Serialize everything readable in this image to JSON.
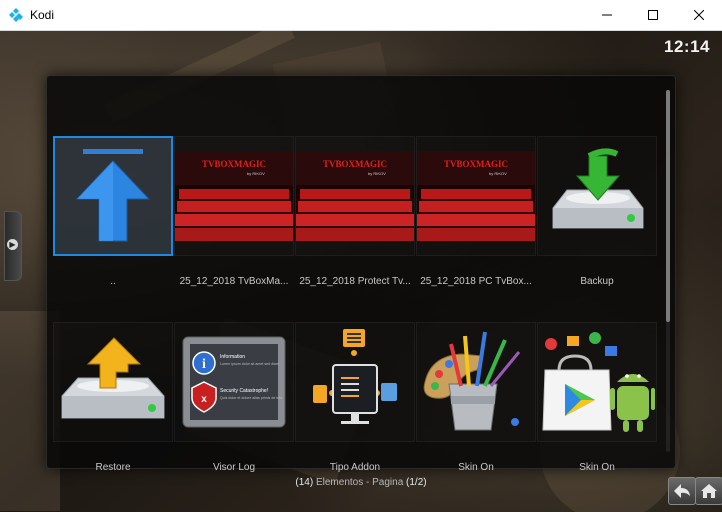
{
  "window": {
    "title": "Kodi",
    "controls": [
      "minimize-icon",
      "maximize-icon",
      "close-icon"
    ]
  },
  "clock": "12:14",
  "grid": {
    "items": [
      {
        "label": "..",
        "icon": "arrow-up-icon"
      },
      {
        "label": "25_12_2018 TvBoxMa...",
        "icon": "cinema-thumbnail"
      },
      {
        "label": "25_12_2018 Protect Tv...",
        "icon": "cinema-thumbnail"
      },
      {
        "label": "25_12_2018 PC TvBox...",
        "icon": "cinema-thumbnail"
      },
      {
        "label": "Backup",
        "icon": "drive-download-icon"
      },
      {
        "label": "Restore",
        "icon": "drive-upload-icon"
      },
      {
        "label": "Visor Log",
        "icon": "log-viewer-icon"
      },
      {
        "label": "Tipo Addon",
        "icon": "addon-type-icon"
      },
      {
        "label": "Skin On",
        "icon": "paint-brushes-icon"
      },
      {
        "label": "Skin On",
        "icon": "play-store-bag-icon"
      }
    ],
    "thumbnail_text": "TVBOXMAGIC",
    "thumbnail_subtext": "by RIKOV",
    "log_text": {
      "title1": "Information",
      "body1": "Lorem ipsum dolor sit amet sed diam",
      "title2": "Security Catastrophe!",
      "body2": "Quis dolor et dolore alias primis de tuta"
    }
  },
  "footer": {
    "count": "(14)",
    "label": " Elementos - Pagina ",
    "page": "(1/2)"
  },
  "colors": {
    "focus": "#1e88e5",
    "background": "#1d1813"
  }
}
